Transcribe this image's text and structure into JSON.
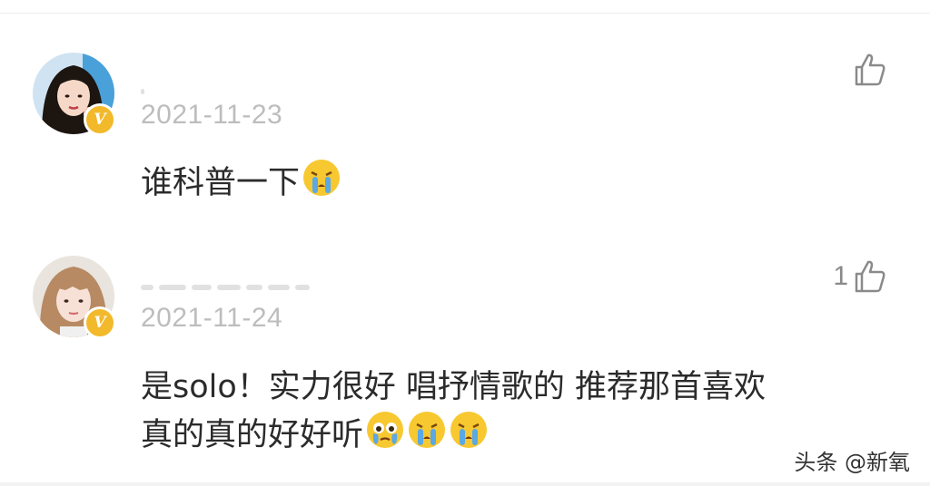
{
  "comments": [
    {
      "timestamp": "2021-11-23",
      "text": "谁科普一下",
      "emojis": [
        "crying-face"
      ],
      "like_count": "",
      "verified_badge": "V"
    },
    {
      "timestamp": "2021-11-24",
      "text_line1": "是solo！实力很好 唱抒情歌的 推荐那首喜欢",
      "text_line2": "真的真的好好听",
      "emojis": [
        "tearful-face",
        "crying-face",
        "crying-face"
      ],
      "like_count": "1",
      "verified_badge": "V"
    }
  ],
  "watermark": "头条 @新氧",
  "colors": {
    "badge": "#f2b92b",
    "timestamp": "#bdbdbd",
    "text": "#2b2b2b",
    "icon": "#8a8a8a"
  }
}
